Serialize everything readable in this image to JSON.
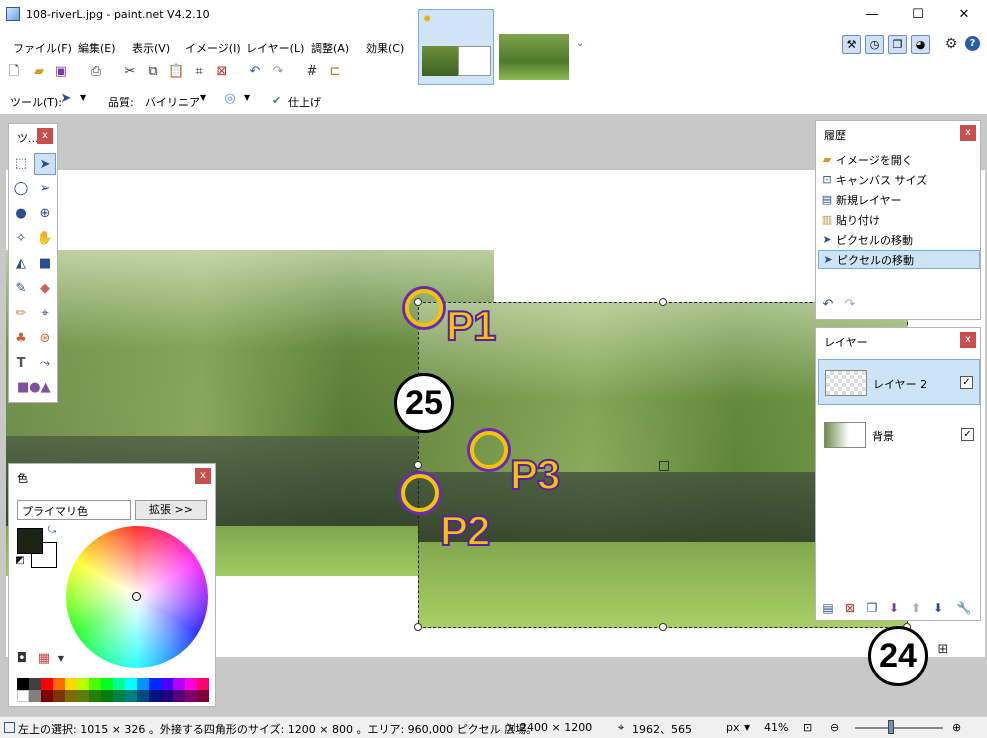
{
  "window": {
    "title": "108-riverL.jpg - paint.net V4.2.10",
    "minimize_glyph": "—",
    "maximize_glyph": "☐",
    "close_glyph": "✕"
  },
  "menu": [
    "ファイル(F)",
    "編集(E)",
    "表示(V)",
    "イメージ(I)",
    "レイヤー(L)",
    "調整(A)",
    "効果(C)"
  ],
  "tool_options": {
    "tool_label": "ツール(T):",
    "quality_label": "品質:",
    "quality_value": "バイリニア",
    "finish_label": "仕上げ"
  },
  "tools_panel": {
    "title": "ツ...",
    "close": "x"
  },
  "colors_panel": {
    "title": "色",
    "close": "x",
    "selected_color": "プライマリ色",
    "expand_label": "拡張 >>",
    "primary_color": "#1d2415",
    "secondary_color": "#ffffff"
  },
  "history_panel": {
    "title": "履歴",
    "close": "x",
    "items": [
      {
        "label": "イメージを開く",
        "icon": "folder-icon"
      },
      {
        "label": "キャンバス サイズ",
        "icon": "canvas-size-icon"
      },
      {
        "label": "新規レイヤー",
        "icon": "new-layer-icon"
      },
      {
        "label": "貼り付け",
        "icon": "paste-icon"
      },
      {
        "label": "ピクセルの移動",
        "icon": "move-pixels-icon"
      },
      {
        "label": "ピクセルの移動",
        "icon": "move-pixels-icon"
      }
    ]
  },
  "layers_panel": {
    "title": "レイヤー",
    "close": "x",
    "layers": [
      {
        "name": "レイヤー 2",
        "visible": "✓"
      },
      {
        "name": "背景",
        "visible": "✓"
      }
    ]
  },
  "annotations": {
    "p1": "P1",
    "p2": "P2",
    "p3": "P3",
    "step25": "25",
    "step24": "24"
  },
  "status": {
    "selection_info": "左上の選択: 1015 × 326 。外接する四角形のサイズ: 1200 × 800 。エリア: 960,000 ピクセル 広場。",
    "image_size": "2400 × 1200",
    "cursor_pos": "1962、565",
    "unit": "px",
    "zoom": "41%"
  },
  "colors": {
    "accent": "#6a9bd6",
    "marker_yellow": "#f5c400",
    "marker_purple": "#5a1fa8",
    "close_red": "#c74f50"
  }
}
